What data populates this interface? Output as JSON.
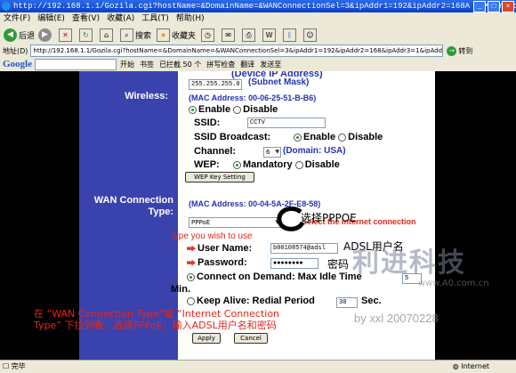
{
  "window": {
    "title": "http://192.168.1.1/Gozila.cgi?hostName=&DomainName=&WANConnectionSel=3&ipAddr1=192&ipAddr2=168A - Microsoft Inter...",
    "minimize": "_",
    "maximize": "□",
    "close": "×"
  },
  "menu": [
    "文件(F)",
    "编辑(E)",
    "查看(V)",
    "收藏(A)",
    "工具(T)",
    "帮助(H)"
  ],
  "toolbar": {
    "back": "后退",
    "search": "搜索",
    "favorites": "收藏夹"
  },
  "address": {
    "label": "地址(D)",
    "url": "http://192.168.1.1/Gozila.cgi?hostName=&DomainName=&WANConnectionSel=3&ipAddr1=192&ipAddr2=168&ipAddr3=1&ipAddr4=1&netMask=0&wirelessSta",
    "go": "转到"
  },
  "googlebar": {
    "logo": "Google",
    "start": "开始",
    "bookmarks": "书签",
    "blocked": "已拦截 50 个",
    "spellcheck": "拼写检查",
    "translate": "翻译",
    "send": "发送至"
  },
  "form": {
    "device_ip_label": "(Device IP Address)",
    "subnet_value": "255.255.255.0",
    "subnet_label": "(Subnet Mask)",
    "wireless_label": "Wireless:",
    "wireless_mac": "(MAC Address: 00-06-25-51-B-B6)",
    "enable": "Enable",
    "disable": "Disable",
    "ssid_label": "SSID:",
    "ssid_value": "CCTV",
    "ssid_broadcast_label": "SSID Broadcast:",
    "channel_label": "Channel:",
    "channel_value": "6",
    "channel_domain": "(Domain: USA)",
    "wep_label": "WEP:",
    "mandatory": "Mandatory",
    "wep_key_button": "WEP Key Setting",
    "wan_label": "WAN Connection Type:",
    "wan_mac": "(MAC Address: 00-04-5A-2F-E8-58)",
    "wan_type_value": "PPPoE",
    "wan_select_text": "Select the Internet connection",
    "wan_select_text2": "type you wish to use",
    "username_label": "User Name:",
    "username_value": "b00108574@adsl",
    "password_label": "Password:",
    "password_value": "●●●●●●●●",
    "connect_on_demand": "Connect on Demand: Max Idle Time",
    "idle_value": "5",
    "min": "Min.",
    "keep_alive": "Keep Alive: Redial Period",
    "redial_value": "30",
    "sec": "Sec.",
    "apply": "Apply",
    "cancel": "Cancel"
  },
  "annotations": {
    "select_pppoe": "选择PPPOE",
    "adsl_user": "ADSL用户名",
    "password": "密码",
    "instruction": "在 “WAN Connection Type”或 “Internet Connection Type” 下拉列表，选择PPPoE，输入ADSL用户名和密码"
  },
  "watermark": {
    "brand": "利进科技",
    "site": "www.A0.com.cn",
    "byline": "by xxl 20070228"
  },
  "status": {
    "left": "完毕",
    "right": "Internet"
  }
}
